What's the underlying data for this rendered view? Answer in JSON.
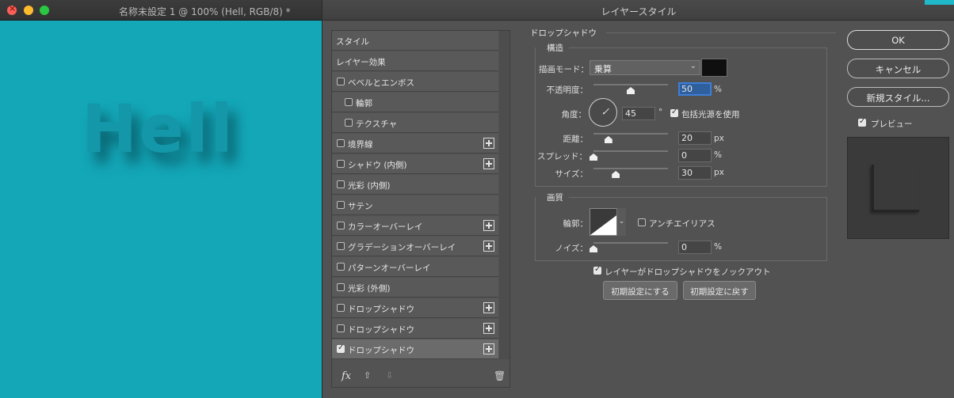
{
  "document": {
    "title": "名称未設定 1 @ 100% (Hell, RGB/8) *",
    "canvas_text": "Hell",
    "canvas_color": "#13a7b8"
  },
  "dialog": {
    "title": "レイヤースタイル",
    "style_list": {
      "header_styles": "スタイル",
      "header_effects": "レイヤー効果",
      "items": [
        {
          "label": "ベベルとエンボス",
          "checked": false,
          "plus": false
        },
        {
          "label": "輪郭",
          "checked": false,
          "plus": false
        },
        {
          "label": "テクスチャ",
          "checked": false,
          "plus": false
        },
        {
          "label": "境界線",
          "checked": false,
          "plus": true
        },
        {
          "label": "シャドウ (内側)",
          "checked": false,
          "plus": true
        },
        {
          "label": "光彩 (内側)",
          "checked": false,
          "plus": false
        },
        {
          "label": "サテン",
          "checked": false,
          "plus": false
        },
        {
          "label": "カラーオーバーレイ",
          "checked": false,
          "plus": true
        },
        {
          "label": "グラデーションオーバーレイ",
          "checked": false,
          "plus": true
        },
        {
          "label": "パターンオーバーレイ",
          "checked": false,
          "plus": false
        },
        {
          "label": "光彩 (外側)",
          "checked": false,
          "plus": false
        },
        {
          "label": "ドロップシャドウ",
          "checked": false,
          "plus": true
        },
        {
          "label": "ドロップシャドウ",
          "checked": false,
          "plus": true
        },
        {
          "label": "ドロップシャドウ",
          "checked": true,
          "plus": true,
          "selected": true
        }
      ],
      "footer": {
        "fx": "fx",
        "up": "⇧",
        "down": "⇩",
        "trash": "🗑"
      }
    },
    "drop_shadow": {
      "section_title": "ドロップシャドウ",
      "structure": {
        "title": "構造",
        "blend_mode_label": "描画モード：",
        "blend_mode_value": "乗算",
        "shadow_color": "#0f0f0f",
        "opacity_label": "不透明度：",
        "opacity_value": "50",
        "opacity_unit": "%",
        "angle_label": "角度：",
        "angle_value": "45",
        "angle_unit": "°",
        "global_light_label": "包括光源を使用",
        "global_light_checked": true,
        "distance_label": "距離：",
        "distance_value": "20",
        "distance_unit": "px",
        "spread_label": "スプレッド：",
        "spread_value": "0",
        "spread_unit": "%",
        "size_label": "サイズ：",
        "size_value": "30",
        "size_unit": "px"
      },
      "quality": {
        "title": "画質",
        "contour_label": "輪郭：",
        "antialias_label": "アンチエイリアス",
        "antialias_checked": false,
        "noise_label": "ノイズ：",
        "noise_value": "0",
        "noise_unit": "%"
      },
      "knockout_label": "レイヤーがドロップシャドウをノックアウト",
      "knockout_checked": true,
      "make_default_label": "初期設定にする",
      "reset_default_label": "初期設定に戻す"
    },
    "actions": {
      "ok": "OK",
      "cancel": "キャンセル",
      "new_style": "新規スタイル...",
      "preview_label": "プレビュー",
      "preview_checked": true
    }
  }
}
